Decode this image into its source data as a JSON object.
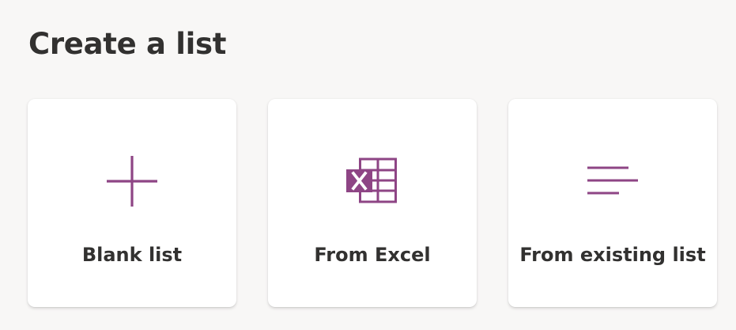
{
  "page": {
    "title": "Create a list"
  },
  "cards": [
    {
      "label": "Blank list",
      "icon": "plus-icon"
    },
    {
      "label": "From Excel",
      "icon": "excel-icon"
    },
    {
      "label": "From existing list",
      "icon": "existing-list-icon"
    }
  ],
  "colors": {
    "accent": "#8e4585",
    "background": "#f8f7f6",
    "card": "#ffffff",
    "text": "#323130"
  }
}
